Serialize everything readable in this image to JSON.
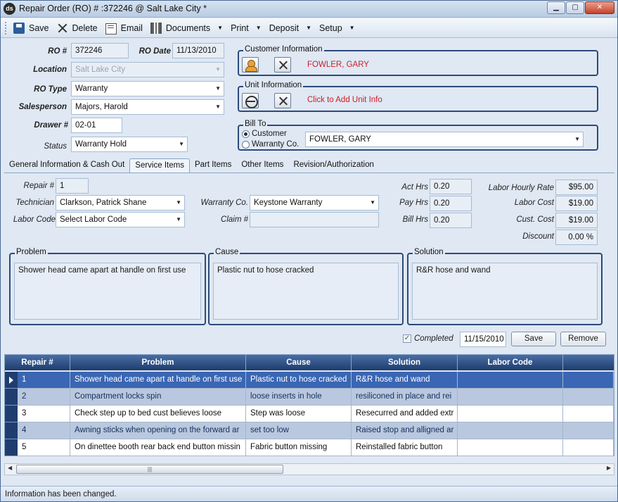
{
  "window": {
    "title": "Repair Order (RO) # :372246 @ Salt Lake City *",
    "app_icon_text": "ds"
  },
  "toolbar": {
    "save": "Save",
    "delete": "Delete",
    "email": "Email",
    "documents": "Documents",
    "print": "Print",
    "deposit": "Deposit",
    "setup": "Setup"
  },
  "header": {
    "ro_label": "RO #",
    "ro_value": "372246",
    "ro_date_label": "RO Date",
    "ro_date_value": "11/13/2010",
    "location_label": "Location",
    "location_value": "Salt Lake City",
    "ro_type_label": "RO Type",
    "ro_type_value": "Warranty",
    "salesperson_label": "Salesperson",
    "salesperson_value": "Majors, Harold",
    "drawer_label": "Drawer #",
    "drawer_value": "02-01",
    "status_label": "Status",
    "status_value": "Warranty Hold"
  },
  "customer_info": {
    "title": "Customer Information",
    "name": "FOWLER, GARY"
  },
  "unit_info": {
    "title": "Unit Information",
    "prompt": "Click to Add Unit Info"
  },
  "bill_to": {
    "title": "Bill To",
    "option_customer": "Customer",
    "option_warranty": "Warranty Co.",
    "selected": "Customer",
    "value": "FOWLER, GARY"
  },
  "tabs": [
    {
      "label": "General Information & Cash Out"
    },
    {
      "label": "Service Items"
    },
    {
      "label": "Part Items"
    },
    {
      "label": "Other Items"
    },
    {
      "label": "Revision/Authorization"
    }
  ],
  "service": {
    "repair_label": "Repair #",
    "repair_value": "1",
    "technician_label": "Technician",
    "technician_value": "Clarkson, Patrick Shane",
    "labor_code_label": "Labor Code",
    "labor_code_value": "Select Labor Code",
    "warranty_co_label": "Warranty Co.",
    "warranty_co_value": "Keystone Warranty",
    "claim_label": "Claim #",
    "claim_value": "",
    "act_hrs_label": "Act Hrs",
    "act_hrs_value": "0.20",
    "pay_hrs_label": "Pay Hrs",
    "pay_hrs_value": "0.20",
    "bill_hrs_label": "Bill Hrs",
    "bill_hrs_value": "0.20",
    "labor_rate_label": "Labor Hourly Rate",
    "labor_rate_value": "$95.00",
    "labor_cost_label": "Labor Cost",
    "labor_cost_value": "$19.00",
    "cust_cost_label": "Cust. Cost",
    "cust_cost_value": "$19.00",
    "discount_label": "Discount",
    "discount_value": "0.00 %",
    "problem_title": "Problem",
    "problem_text": "Shower head came apart at handle on first use",
    "cause_title": "Cause",
    "cause_text": "Plastic nut to hose cracked",
    "solution_title": "Solution",
    "solution_text": "R&R hose and wand",
    "completed_label": "Completed",
    "completed_checked": true,
    "completed_date": "11/15/2010",
    "save_button": "Save",
    "remove_button": "Remove"
  },
  "grid": {
    "columns": [
      "Repair #",
      "Problem",
      "Cause",
      "Solution",
      "Labor Code"
    ],
    "rows": [
      {
        "repair": "1",
        "problem": "Shower head came apart at handle on first use",
        "cause": "Plastic nut to hose cracked",
        "solution": "R&R hose and wand",
        "labor_code": ""
      },
      {
        "repair": "2",
        "problem": "Compartment locks spin",
        "cause": "loose inserts in hole",
        "solution": "resiliconed in place and rei",
        "labor_code": ""
      },
      {
        "repair": "3",
        "problem": "Check step up to bed cust believes loose",
        "cause": "Step was loose",
        "solution": "Resecurred and added extr",
        "labor_code": ""
      },
      {
        "repair": "4",
        "problem": "Awning sticks when opening on the forward ar",
        "cause": "set too low",
        "solution": "Raised stop and alligned ar",
        "labor_code": ""
      },
      {
        "repair": "5",
        "problem": "On dinettee booth rear back end button missin",
        "cause": "Fabric button missing",
        "solution": "Reinstalled fabric button",
        "labor_code": ""
      }
    ]
  },
  "status_bar": {
    "message": "Information has been changed."
  }
}
